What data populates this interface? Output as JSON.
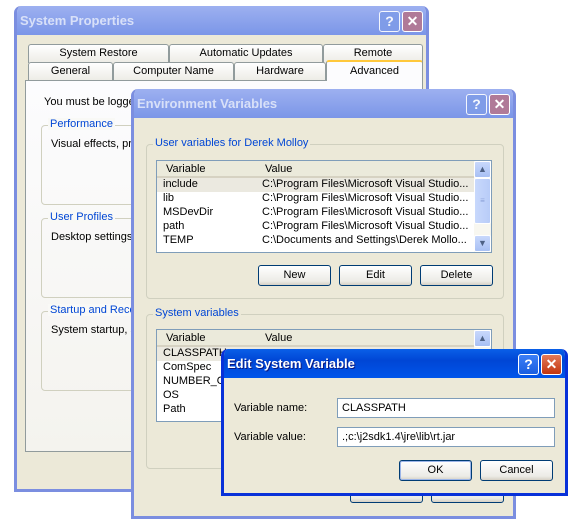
{
  "system_properties": {
    "title": "System Properties",
    "tabs_row1": [
      "System Restore",
      "Automatic Updates",
      "Remote"
    ],
    "tabs_row2": [
      "General",
      "Computer Name",
      "Hardware",
      "Advanced"
    ],
    "active_tab": "Advanced",
    "intro": "You must be logge",
    "groups": [
      {
        "label": "Performance",
        "text": "Visual effects, pro"
      },
      {
        "label": "User Profiles",
        "text": "Desktop settings"
      },
      {
        "label": "Startup and Reco",
        "text": "System startup, sy"
      }
    ]
  },
  "env_vars": {
    "title": "Environment Variables",
    "user_group_label": "User variables for Derek Molloy",
    "columns": [
      "Variable",
      "Value"
    ],
    "user_vars": [
      {
        "name": "include",
        "value": "C:\\Program Files\\Microsoft Visual Studio..."
      },
      {
        "name": "lib",
        "value": "C:\\Program Files\\Microsoft Visual Studio..."
      },
      {
        "name": "MSDevDir",
        "value": "C:\\Program Files\\Microsoft Visual Studio..."
      },
      {
        "name": "path",
        "value": "C:\\Program Files\\Microsoft Visual Studio..."
      },
      {
        "name": "TEMP",
        "value": "C:\\Documents and Settings\\Derek Mollo..."
      }
    ],
    "buttons": {
      "new": "New",
      "edit": "Edit",
      "delete": "Delete",
      "ok": "OK",
      "cancel": "Cancel"
    },
    "system_group_label": "System variables",
    "system_vars": [
      "CLASSPATH",
      "ComSpec",
      "NUMBER_OF",
      "OS",
      "Path"
    ]
  },
  "edit_dialog": {
    "title": "Edit System Variable",
    "name_label": "Variable name:",
    "value_label": "Variable value:",
    "name_value": "CLASSPATH",
    "value_value": ".;c:\\j2sdk1.4\\jre\\lib\\rt.jar",
    "ok": "OK",
    "cancel": "Cancel"
  },
  "icons": {
    "help": "?",
    "close": "✕",
    "scroll_up": "▲",
    "scroll_down": "▼"
  }
}
